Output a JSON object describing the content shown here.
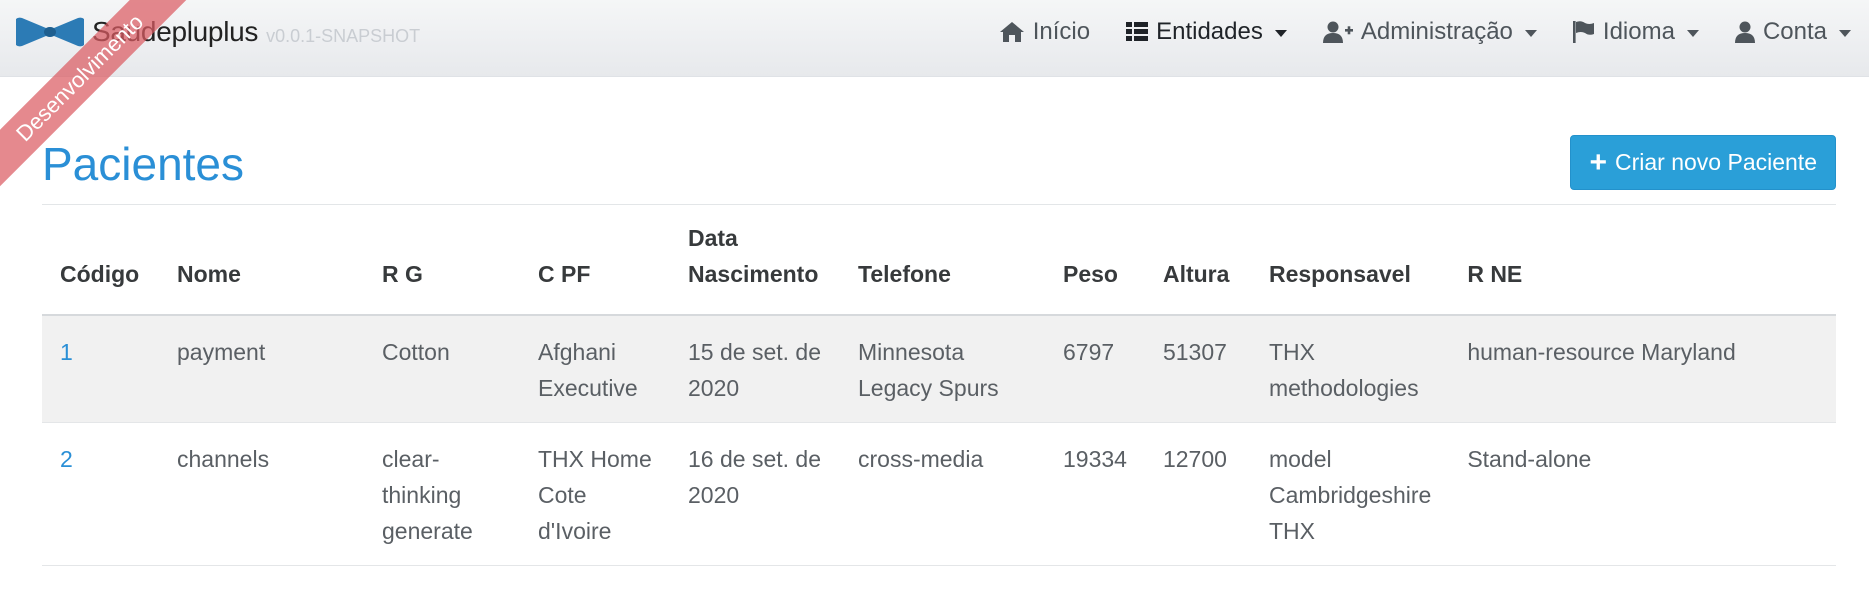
{
  "brand": {
    "name": "Saudepluplus",
    "version": "v0.0.1-SNAPSHOT"
  },
  "ribbon": "Desenvolvimento",
  "nav": {
    "home": "Início",
    "entities": "Entidades",
    "admin": "Administração",
    "language": "Idioma",
    "account": "Conta"
  },
  "page": {
    "title": "Pacientes",
    "create_label": "Criar novo Paciente"
  },
  "table": {
    "headers": [
      "Código",
      "Nome",
      "R G",
      "C PF",
      "Data Nascimento",
      "Telefone",
      "Peso",
      "Altura",
      "Responsavel",
      "R NE"
    ],
    "rows": [
      [
        "1",
        "payment",
        "Cotton",
        "Afghani Executive",
        "15 de set. de 2020",
        "Minnesota Legacy Spurs",
        "6797",
        "51307",
        "THX methodologies",
        "human-resource Maryland"
      ],
      [
        "2",
        "channels",
        "clear-thinking generate",
        "THX Home Cote d'Ivoire",
        "16 de set. de 2020",
        "cross-media",
        "19334",
        "12700",
        "model Cambridgeshire THX",
        "Stand-alone"
      ]
    ]
  },
  "colors": {
    "primary": "#2a9fd8",
    "title": "#2a8fd6",
    "ribbon": "#db5c62"
  }
}
